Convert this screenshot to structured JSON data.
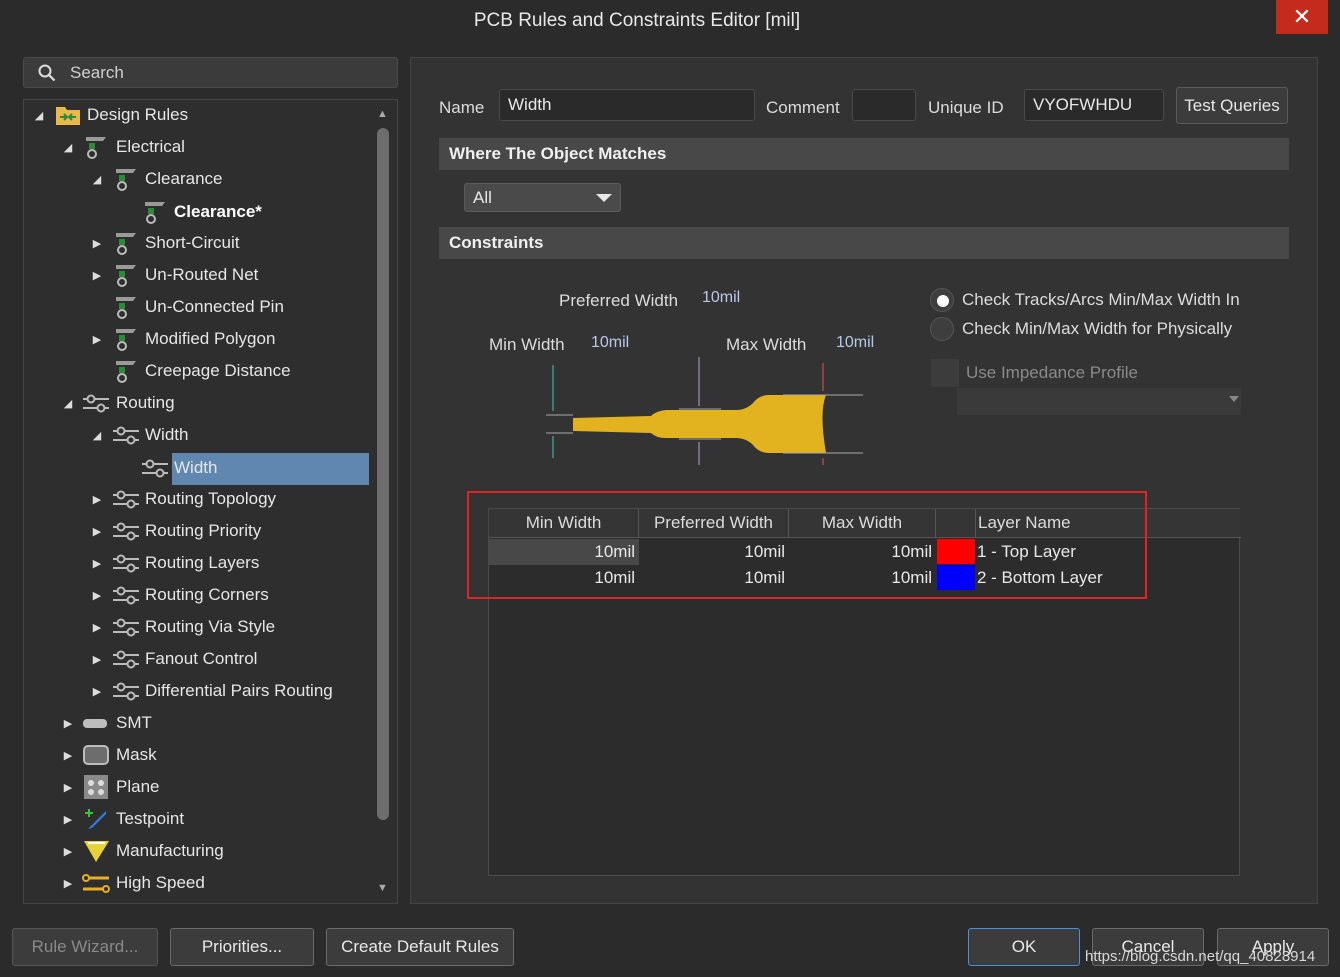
{
  "window": {
    "title": "PCB Rules and Constraints Editor [mil]",
    "close": "✕"
  },
  "search": {
    "placeholder": "Search"
  },
  "tree": {
    "design_rules": "Design Rules",
    "electrical": "Electrical",
    "clearance": "Clearance",
    "clearance_rule": "Clearance*",
    "short_circuit": "Short-Circuit",
    "unrouted_net": "Un-Routed Net",
    "unconnected_pin": "Un-Connected Pin",
    "modified_polygon": "Modified Polygon",
    "creepage_distance": "Creepage Distance",
    "routing": "Routing",
    "width": "Width",
    "width_rule": "Width",
    "routing_topology": "Routing Topology",
    "routing_priority": "Routing Priority",
    "routing_layers": "Routing Layers",
    "routing_corners": "Routing Corners",
    "routing_via_style": "Routing Via Style",
    "fanout_control": "Fanout Control",
    "diff_pairs": "Differential Pairs Routing",
    "smt": "SMT",
    "mask": "Mask",
    "plane": "Plane",
    "testpoint": "Testpoint",
    "manufacturing": "Manufacturing",
    "high_speed": "High Speed"
  },
  "rule": {
    "name_label": "Name",
    "name_value": "Width",
    "comment_label": "Comment",
    "comment_value": "",
    "unique_id_label": "Unique ID",
    "unique_id_value": "VYOFWHDU",
    "test_queries": "Test Queries"
  },
  "where": {
    "header": "Where The Object Matches",
    "scope": "All"
  },
  "constraints": {
    "header": "Constraints",
    "preferred_label": "Preferred Width",
    "preferred_value": "10mil",
    "min_label": "Min Width",
    "min_value": "10mil",
    "max_label": "Max Width",
    "max_value": "10mil",
    "radio1": "Check Tracks/Arcs Min/Max Width In",
    "radio2": "Check Min/Max Width for Physically",
    "impedance": "Use Impedance Profile"
  },
  "grid": {
    "headers": [
      "Min Width",
      "Preferred Width",
      "Max Width",
      "Layer Name"
    ],
    "rows": [
      {
        "min": "10mil",
        "pref": "10mil",
        "max": "10mil",
        "color": "#ff0000",
        "layer": "1 - Top Layer"
      },
      {
        "min": "10mil",
        "pref": "10mil",
        "max": "10mil",
        "color": "#0000ff",
        "layer": "2 - Bottom Layer"
      }
    ]
  },
  "buttons": {
    "rule_wizard": "Rule Wizard...",
    "priorities": "Priorities...",
    "create_default": "Create Default Rules",
    "ok": "OK",
    "cancel": "Cancel",
    "apply": "Apply"
  },
  "watermark": "https://blog.csdn.net/qq_40828914",
  "colors": {
    "track": "#e3b21f",
    "selection": "#5f87b0",
    "highlight_box": "#e02424"
  }
}
